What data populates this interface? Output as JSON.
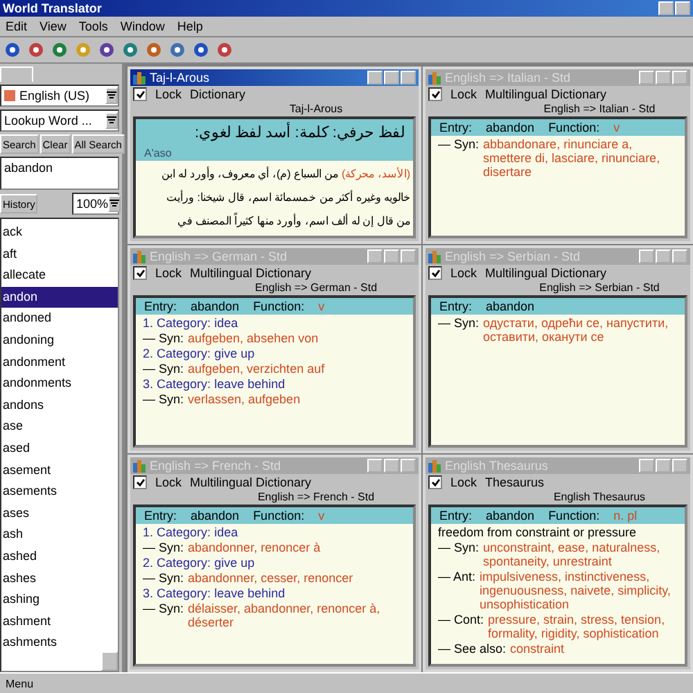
{
  "window": {
    "title": "World Translator"
  },
  "menu": [
    "Edit",
    "View",
    "Tools",
    "Window",
    "Help"
  ],
  "sidebar": {
    "language": "English (US)",
    "lookup": "Lookup Word ...",
    "buttons": [
      "Search",
      "Clear",
      "All Search"
    ],
    "word": "abandon",
    "history_button": "History",
    "zoom": "100%",
    "words": [
      {
        "text": "ack",
        "selected": false
      },
      {
        "text": "aft",
        "selected": false
      },
      {
        "text": "allecate",
        "selected": false
      },
      {
        "text": "andon",
        "selected": true
      },
      {
        "text": "andoned",
        "selected": false
      },
      {
        "text": "andoning",
        "selected": false
      },
      {
        "text": "andonment",
        "selected": false
      },
      {
        "text": "andonments",
        "selected": false
      },
      {
        "text": "andons",
        "selected": false
      },
      {
        "text": "ase",
        "selected": false
      },
      {
        "text": "ased",
        "selected": false
      },
      {
        "text": "asement",
        "selected": false
      },
      {
        "text": "asements",
        "selected": false
      },
      {
        "text": "ases",
        "selected": false
      },
      {
        "text": "ash",
        "selected": false
      },
      {
        "text": "ashed",
        "selected": false
      },
      {
        "text": "ashes",
        "selected": false
      },
      {
        "text": "ashing",
        "selected": false
      },
      {
        "text": "ashment",
        "selected": false
      },
      {
        "text": "ashments",
        "selected": false
      }
    ]
  },
  "windows": [
    {
      "kind": "arabic",
      "title": "Taj-l-Arous",
      "active": true,
      "lock_label": "Lock",
      "lock_checked": true,
      "source": "Dictionary",
      "header": "Taj-l-Arous",
      "band": "لفظ حرفي:   كلمة: أسد   لفظ لغوي:",
      "band_note": "A'aso",
      "lines": [
        {
          "highlight": "(الأسد، محركة)",
          "text": " من السباع (م)، أي معروف، وأورد له ابن"
        },
        {
          "text": "خالويه وغيره أكثر من خمسمائة اسم، قال شيخنا: ورأيت"
        },
        {
          "text": "من قال إن له ألف اسم، وأورد منها كثيراً المصنف في"
        }
      ]
    },
    {
      "kind": "entry",
      "title": "English => Italian - Std",
      "active": false,
      "lock_label": "Lock",
      "lock_checked": true,
      "source": "Multilingual Dictionary",
      "header": "English => Italian - Std",
      "entry_label": "Entry:",
      "entry": "abandon",
      "function_label": "Function:",
      "function": "v",
      "lines": [
        {
          "kind": "relation",
          "label": "— Syn:",
          "value": "abbandonare, rinunciare a, smettere di, lasciare, rinunciare, disertare"
        }
      ]
    },
    {
      "kind": "entry",
      "title": "English => German - Std",
      "active": false,
      "lock_label": "Lock",
      "lock_checked": true,
      "source": "Multilingual Dictionary",
      "header": "English => German - Std",
      "entry_label": "Entry:",
      "entry": "abandon",
      "function_label": "Function:",
      "function": "v",
      "lines": [
        {
          "kind": "category",
          "number": "1.",
          "label": "Category:",
          "value": "idea"
        },
        {
          "kind": "relation",
          "label": "— Syn:",
          "value": "aufgeben, absehen von"
        },
        {
          "kind": "category",
          "number": "2.",
          "label": "Category:",
          "value": "give up"
        },
        {
          "kind": "relation",
          "label": "— Syn:",
          "value": "aufgeben, verzichten auf"
        },
        {
          "kind": "category",
          "number": "3.",
          "label": "Category:",
          "value": "leave behind"
        },
        {
          "kind": "relation",
          "label": "— Syn:",
          "value": "verlassen, aufgeben"
        }
      ]
    },
    {
      "kind": "entry",
      "title": "English => Serbian - Std",
      "active": false,
      "lock_label": "Lock",
      "lock_checked": true,
      "source": "Multilingual Dictionary",
      "header": "English => Serbian - Std",
      "entry_label": "Entry:",
      "entry": "abandon",
      "lines": [
        {
          "kind": "relation",
          "label": "— Syn:",
          "value": "одустати, одрећи се, напустити, оставити, оканути се"
        }
      ]
    },
    {
      "kind": "entry",
      "title": "English => French - Std",
      "active": false,
      "lock_label": "Lock",
      "lock_checked": true,
      "source": "Multilingual Dictionary",
      "header": "English => French - Std",
      "entry_label": "Entry:",
      "entry": "abandon",
      "function_label": "Function:",
      "function": "v",
      "lines": [
        {
          "kind": "category",
          "number": "1.",
          "label": "Category:",
          "value": "idea"
        },
        {
          "kind": "relation",
          "label": "— Syn:",
          "value": "abandonner, renoncer à"
        },
        {
          "kind": "category",
          "number": "2.",
          "label": "Category:",
          "value": "give up"
        },
        {
          "kind": "relation",
          "label": "— Syn:",
          "value": "abandonner, cesser, renoncer"
        },
        {
          "kind": "category",
          "number": "3.",
          "label": "Category:",
          "value": "leave behind"
        },
        {
          "kind": "relation",
          "label": "— Syn:",
          "value": "délaisser, abandonner, renoncer à, déserter"
        }
      ]
    },
    {
      "kind": "entry",
      "title": "English Thesaurus",
      "active": false,
      "lock_label": "Lock",
      "lock_checked": true,
      "source": "Thesaurus",
      "header": "English Thesaurus",
      "entry_label": "Entry:",
      "entry": "abandon",
      "function_label": "Function:",
      "function": "n. pl",
      "lines": [
        {
          "kind": "definition",
          "text": "freedom from constraint or pressure"
        },
        {
          "kind": "relation",
          "label": "— Syn:",
          "value": "unconstraint, ease, naturalness, spontaneity, unrestraint"
        },
        {
          "kind": "relation",
          "label": "— Ant:",
          "value": "impulsiveness, instinctiveness, ingenuousness, naivete, simplicity, unsophistication"
        },
        {
          "kind": "relation",
          "label": "— Cont:",
          "value": "pressure, strain, stress, tension, formality, rigidity, sophistication"
        },
        {
          "kind": "relation",
          "label": "— See also:",
          "value": "constraint"
        }
      ]
    }
  ],
  "status_bar": "Menu"
}
